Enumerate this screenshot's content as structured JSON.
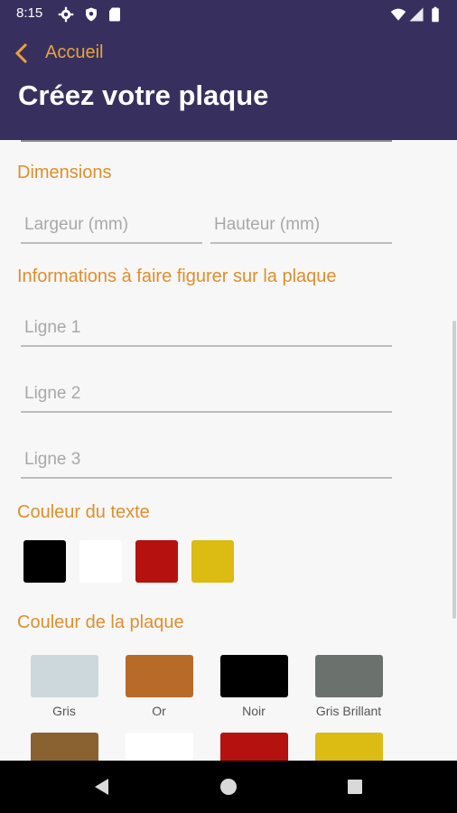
{
  "status": {
    "time": "8:15"
  },
  "header": {
    "back_label": "Accueil",
    "title": "Créez votre plaque"
  },
  "dimensions": {
    "title": "Dimensions",
    "width_placeholder": "Largeur (mm)",
    "height_placeholder": "Hauteur (mm)"
  },
  "info": {
    "title": "Informations à faire figurer sur la plaque",
    "line1_placeholder": "Ligne 1",
    "line2_placeholder": "Ligne 2",
    "line3_placeholder": "Ligne 3"
  },
  "text_color": {
    "title": "Couleur du texte",
    "swatches": [
      {
        "name": "black",
        "color": "#000000"
      },
      {
        "name": "white",
        "color": "#ffffff"
      },
      {
        "name": "red",
        "color": "#b5110f"
      },
      {
        "name": "yellow",
        "color": "#dcbb12"
      }
    ]
  },
  "plate_color": {
    "title": "Couleur de la plaque",
    "options": [
      {
        "label": "Gris",
        "color": "#ccd8dc"
      },
      {
        "label": "Or",
        "color": "#b86a28"
      },
      {
        "label": "Noir",
        "color": "#000000"
      },
      {
        "label": "Gris Brillant",
        "color": "#6b726e"
      }
    ],
    "next_row_colors": [
      "#8a6232",
      "#ffffff",
      "#b5110f",
      "#dcbb12"
    ]
  },
  "colors": {
    "header_bg": "#37305f",
    "accent": "#e08e2c"
  }
}
